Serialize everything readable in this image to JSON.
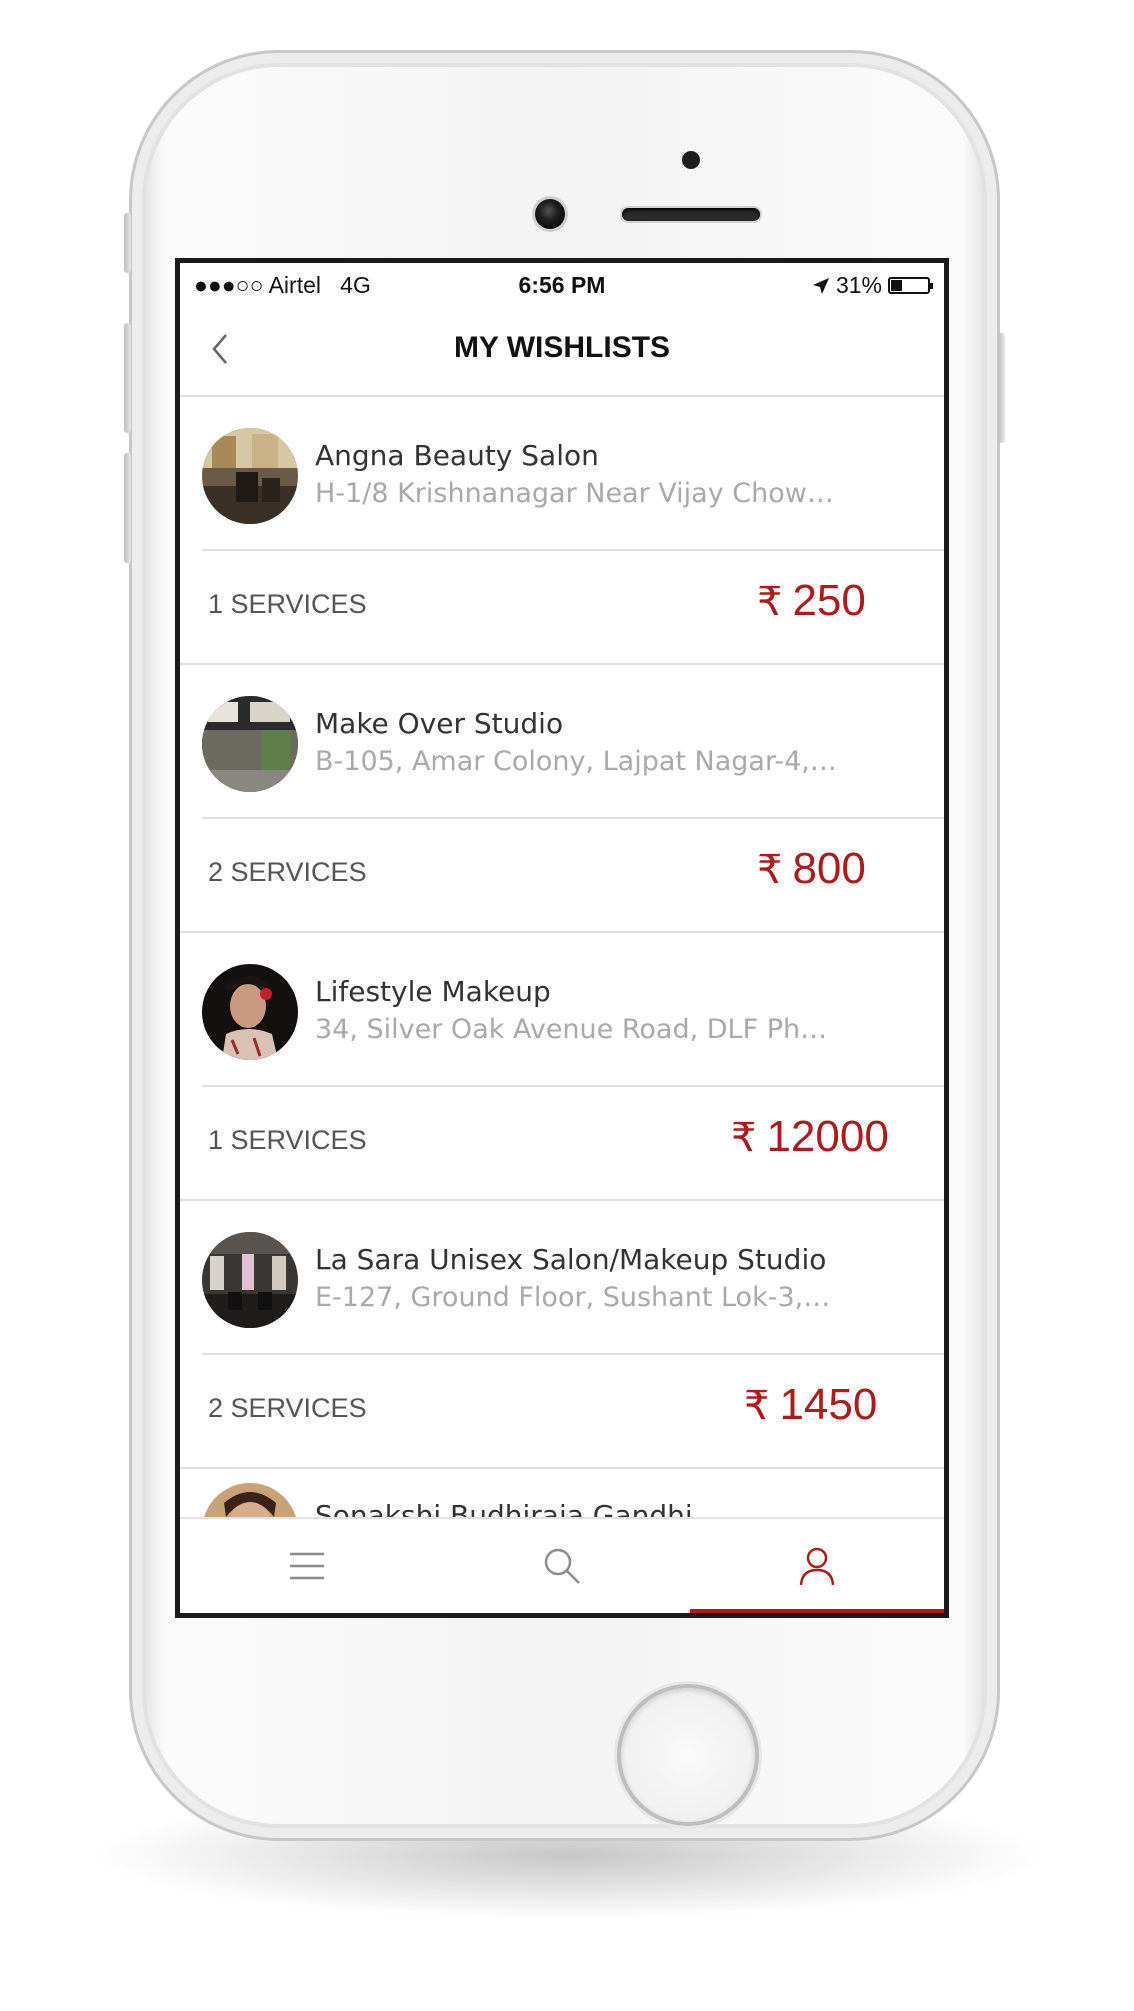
{
  "status_bar": {
    "carrier": "●●●○○ Airtel   4G",
    "time": "6:56 PM",
    "battery": "31%",
    "battery_level": 0.31
  },
  "header": {
    "title": "MY WISHLISTS"
  },
  "wishlist": [
    {
      "name": "Angna Beauty Salon",
      "address": "H-1/8 Krishnanagar Near Vijay Chow…",
      "services": "1 SERVICES",
      "price": "250"
    },
    {
      "name": "Make Over Studio",
      "address": "B-105, Amar Colony, Lajpat Nagar-4,…",
      "services": "2 SERVICES",
      "price": "800"
    },
    {
      "name": "Lifestyle Makeup",
      "address": "34, Silver Oak Avenue Road, DLF Ph…",
      "services": "1 SERVICES",
      "price": "12000"
    },
    {
      "name": "La Sara Unisex Salon/Makeup Studio",
      "address": "E-127, Ground Floor, Sushant Lok-3,…",
      "services": "2 SERVICES",
      "price": "1450"
    }
  ],
  "partial_item": {
    "name": "Sonakshi Budhiraja Gandhi"
  },
  "currency_symbol": "₹",
  "tabbar": {
    "active": "profile"
  },
  "colors": {
    "accent": "#b21a1a",
    "divider": "#e0e0e0",
    "muted_text": "#a9a9a9"
  }
}
